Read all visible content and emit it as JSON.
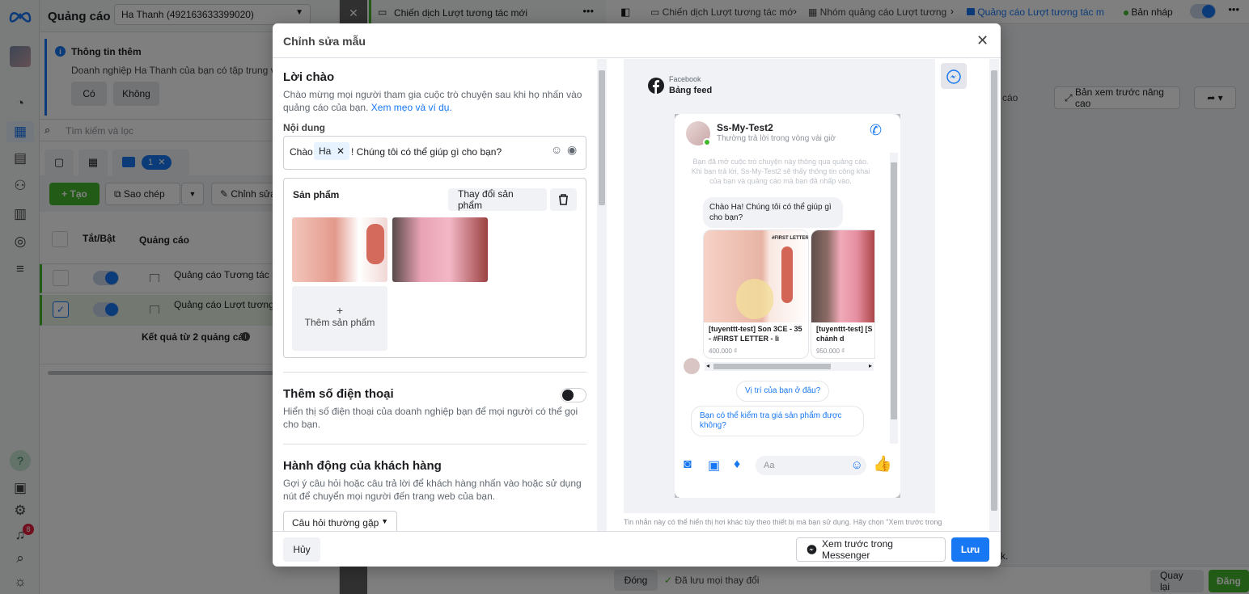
{
  "app": {
    "section_title": "Quảng cáo",
    "account_select": "Ha Thanh (492163633399020)",
    "notif_count": "8"
  },
  "info_banner": {
    "title": "Thông tin thêm",
    "text": "Doanh nghiệp Ha Thanh của bạn có tập trung vào",
    "yes": "Có",
    "no": "Không"
  },
  "search": {
    "placeholder": "Tìm kiếm và lọc"
  },
  "toolbar": {
    "selected_count": "1",
    "create": "Tạo",
    "copy": "Sao chép",
    "edit": "Chỉnh sửa"
  },
  "table": {
    "col_toggle": "Tắt/Bật",
    "col_ad": "Quảng cáo",
    "rows": [
      {
        "name": "Quảng cáo Tương tác m"
      },
      {
        "name": "Quảng cáo Lượt tương t"
      }
    ],
    "summary": "Kết quả từ 2 quảng cáo"
  },
  "middle_column": {
    "campaign_name": "Chiến dịch Lượt tương tác mới"
  },
  "breadcrumb": {
    "campaign": "Chiến dịch Lượt tương tác mớ",
    "adset": "Nhóm quảng cáo Lượt tương",
    "ad": "Quảng cáo Lượt tương tác m",
    "status": "Bản nháp"
  },
  "right_panel": {
    "partial_label": "cáo",
    "advanced_preview": "Bản xem trước nâng cao",
    "footer_partial": "k.",
    "close": "Đóng",
    "saved": "Đã lưu mọi thay đổi",
    "back": "Quay lại",
    "publish": "Đăng"
  },
  "modal": {
    "title": "Chỉnh sửa mẫu",
    "greeting_title": "Lời chào",
    "greeting_desc": "Chào mừng mọi người tham gia cuộc trò chuyện sau khi họ nhấn vào quảng cáo của bạn.",
    "greeting_link": "Xem mẹo và ví dụ.",
    "content_label": "Nội dung",
    "content_prefix": "Chào",
    "content_token": "Ha",
    "content_suffix": "! Chúng tôi có thể giúp gì cho bạn?",
    "products_label": "Sản phẩm",
    "change_products": "Thay đổi sản phẩm",
    "add_product": "Thêm sản phẩm",
    "phone_title": "Thêm số điện thoại",
    "phone_desc": "Hiển thị số điện thoại của doanh nghiệp bạn để mọi người có thể gọi cho bạn.",
    "action_title": "Hành động của khách hàng",
    "action_desc": "Gợi ý câu hỏi hoặc câu trả lời để khách hàng nhấn vào hoặc sử dụng nút để chuyển mọi người đến trang web của bạn.",
    "faq_select": "Câu hỏi thường gặp",
    "cancel": "Hủy",
    "preview_messenger": "Xem trước trong Messenger",
    "save": "Lưu",
    "disclaimer": "Tin nhắn này có thể hiển thị hơi khác tùy theo thiết bị mà bạn sử dụng. Hãy chọn \"Xem trước trong"
  },
  "preview": {
    "platform": "Facebook",
    "placement": "Bảng feed",
    "page_name": "Ss-My-Test2",
    "page_status": "Thường trả lời trong vòng vài giờ",
    "system_note": "Bạn đã mở cuộc trò chuyện này thông qua quảng cáo. Khi bạn trả lời, Ss-My-Test2 sẽ thấy thông tin công khai của bạn và quảng cáo mà bạn đã nhấp vào.",
    "greeting_bubble": "Chào Ha! Chúng tôi có thể giúp gì cho bạn?",
    "products": [
      {
        "title": "[tuyenttt-test] Son 3CE - 35 - #FIRST LETTER - lì",
        "price": "400.000 ₫",
        "image_text": "#FIRST LETTER"
      },
      {
        "title": "[tuyenttt-test] [S áo sang chảnh d",
        "price": "950.000 ₫"
      }
    ],
    "quick_replies": [
      "Vị trí của bạn ở đâu?",
      "Bạn có thể kiểm tra giá sản phẩm được không?"
    ],
    "composer_placeholder": "Aa"
  },
  "colors": {
    "brand_blue": "#1877f2",
    "green": "#42b72a",
    "publish_green": "#42b72a"
  }
}
